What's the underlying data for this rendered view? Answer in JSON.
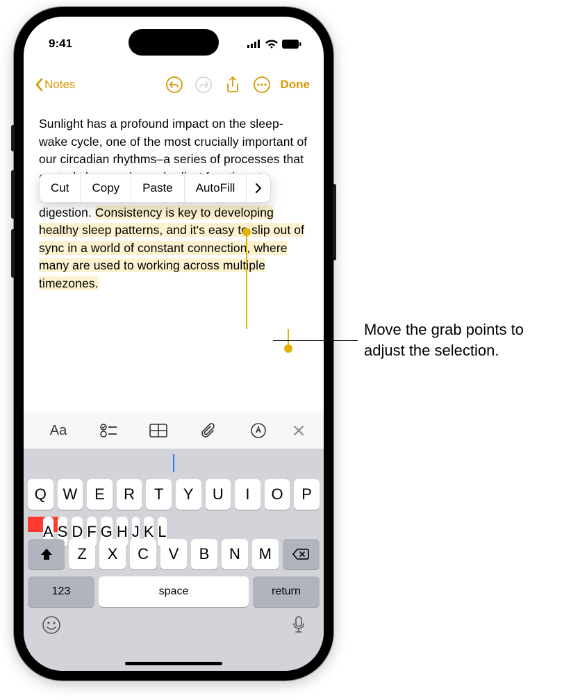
{
  "status": {
    "time": "9:41"
  },
  "toolbar": {
    "back_label": "Notes",
    "done_label": "Done"
  },
  "note": {
    "text_before_highlight": "Sunlight has a profound impact on the sleep-wake cycle, one of the most crucially important of our circadian rhythms–a series of processes that control changes in our bodies' functions to optimize everything from wakefulness to digestion. ",
    "highlighted_text": "Consistency is key to developing healthy sleep patterns, and it's easy to slip out of sync in a world of constant connection, where many are used to working across multiple timezones."
  },
  "popup": {
    "cut": "Cut",
    "copy": "Copy",
    "paste": "Paste",
    "autofill": "AutoFill"
  },
  "format_bar": {
    "aa": "Aa"
  },
  "keyboard": {
    "row1": [
      "Q",
      "W",
      "E",
      "R",
      "T",
      "Y",
      "U",
      "I",
      "O",
      "P"
    ],
    "row2": [
      "A",
      "S",
      "D",
      "F",
      "G",
      "H",
      "J",
      "K",
      "L"
    ],
    "row3": [
      "Z",
      "X",
      "C",
      "V",
      "B",
      "N",
      "M"
    ],
    "numeric": "123",
    "space": "space",
    "return": "return"
  },
  "callout": {
    "text": "Move the grab points to adjust the selection."
  }
}
